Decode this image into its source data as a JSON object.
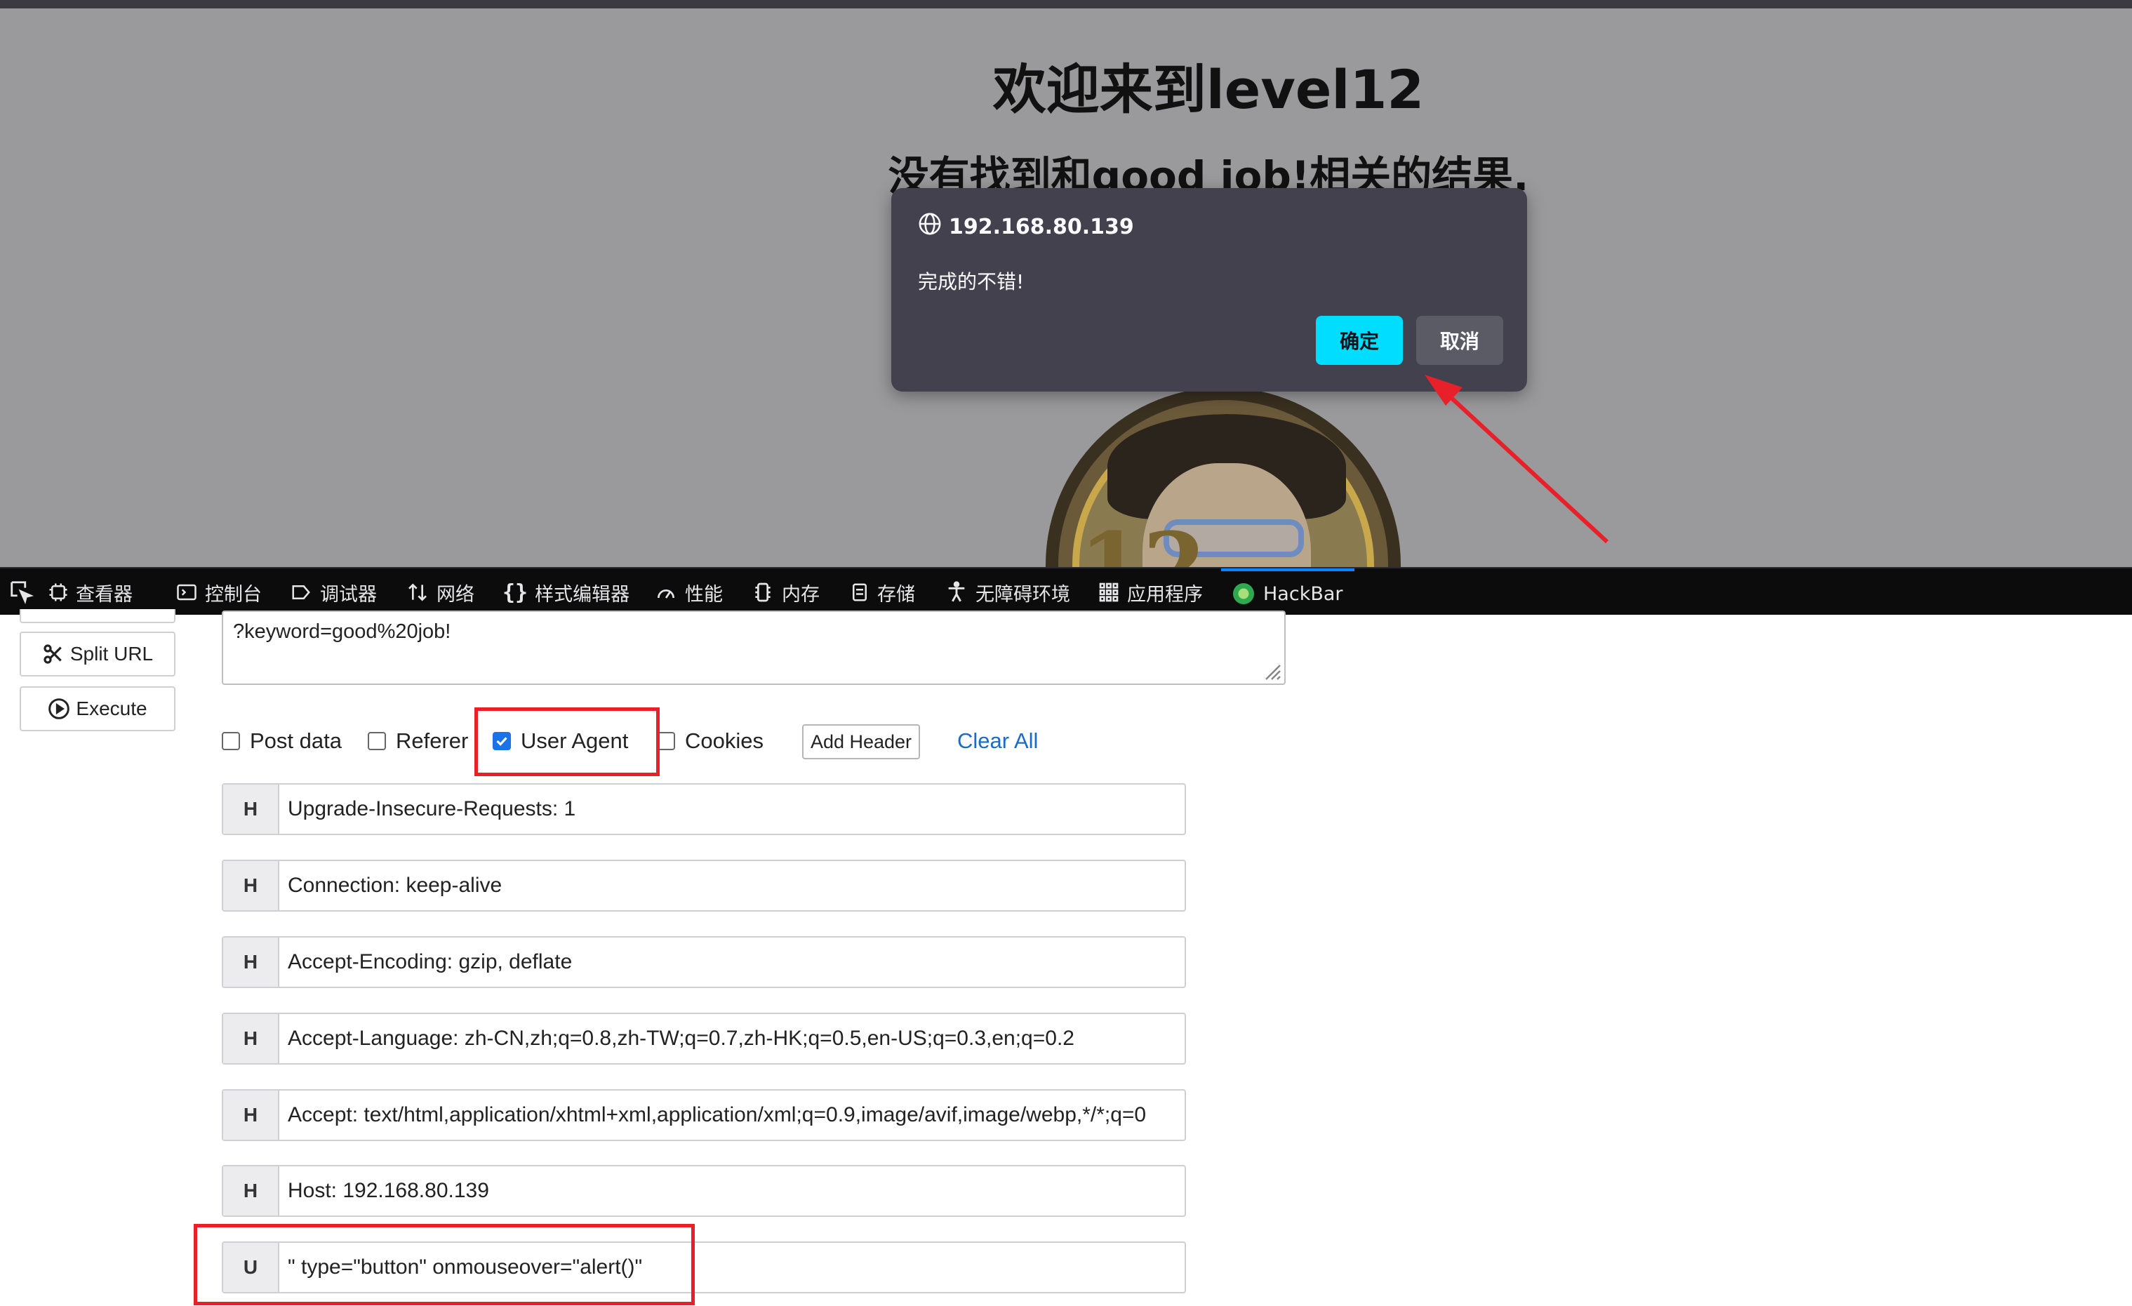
{
  "page": {
    "heading": "欢迎来到level12",
    "result": "没有找到和good job!相关的结果."
  },
  "alert": {
    "origin": "192.168.80.139",
    "message": "完成的不错!",
    "ok_label": "确定",
    "cancel_label": "取消",
    "ok_color": "#00ddff"
  },
  "devtools": {
    "tabs": [
      {
        "label": "查看器",
        "icon": "inspector-icon"
      },
      {
        "label": "控制台",
        "icon": "console-icon"
      },
      {
        "label": "调试器",
        "icon": "debugger-icon"
      },
      {
        "label": "网络",
        "icon": "network-icon"
      },
      {
        "label": "样式编辑器",
        "icon": "style-editor-icon"
      },
      {
        "label": "性能",
        "icon": "performance-icon"
      },
      {
        "label": "内存",
        "icon": "memory-icon"
      },
      {
        "label": "存储",
        "icon": "storage-icon"
      },
      {
        "label": "无障碍环境",
        "icon": "accessibility-icon"
      },
      {
        "label": "应用程序",
        "icon": "application-icon"
      },
      {
        "label": "HackBar",
        "icon": "hackbar-icon",
        "active": true
      }
    ]
  },
  "hackbar": {
    "split_url_label": "Split URL",
    "execute_label": "Execute",
    "url_value": "?keyword=good%20job!",
    "options": {
      "post_data": {
        "label": "Post data",
        "checked": false
      },
      "referer": {
        "label": "Referer",
        "checked": false
      },
      "user_agent": {
        "label": "User Agent",
        "checked": true
      },
      "cookies": {
        "label": "Cookies",
        "checked": false
      }
    },
    "add_header_label": "Add Header",
    "clear_all_label": "Clear All",
    "headers": [
      {
        "tag": "H",
        "value": "Upgrade-Insecure-Requests: 1"
      },
      {
        "tag": "H",
        "value": "Connection: keep-alive"
      },
      {
        "tag": "H",
        "value": "Accept-Encoding: gzip, deflate"
      },
      {
        "tag": "H",
        "value": "Accept-Language: zh-CN,zh;q=0.8,zh-TW;q=0.7,zh-HK;q=0.5,en-US;q=0.3,en;q=0.2"
      },
      {
        "tag": "H",
        "value": "Accept: text/html,application/xhtml+xml,application/xml;q=0.9,image/avif,image/webp,*/*;q=0"
      },
      {
        "tag": "H",
        "value": "Host: 192.168.80.139"
      },
      {
        "tag": "U",
        "value": "\" type=\"button\" onmouseover=\"alert()\""
      }
    ]
  },
  "annotation_color": "#e8202a"
}
